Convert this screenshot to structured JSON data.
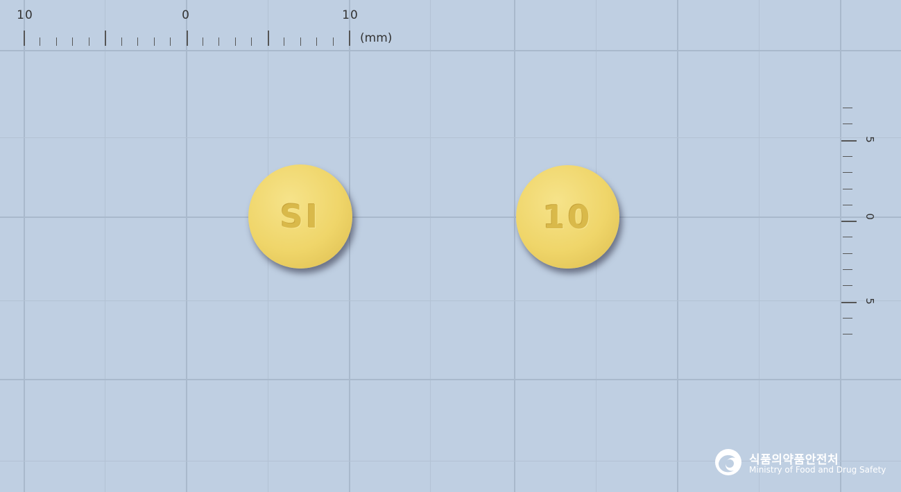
{
  "image": {
    "description_type": "pill identification photo on mm grid",
    "background_color": "#bfcfe2",
    "pill_color": "#efd569"
  },
  "ruler_top": {
    "labels": [
      "10",
      "0",
      "10"
    ],
    "unit": "(mm)"
  },
  "ruler_right": {
    "labels": [
      "5",
      "0",
      "5"
    ]
  },
  "pills": [
    {
      "side": "front",
      "imprint": "SI"
    },
    {
      "side": "back",
      "imprint": "10"
    }
  ],
  "logo": {
    "icon": "mfds-emblem-icon",
    "korean_name": "식품의약품안전처",
    "english_name": "Ministry of Food and Drug Safety"
  }
}
